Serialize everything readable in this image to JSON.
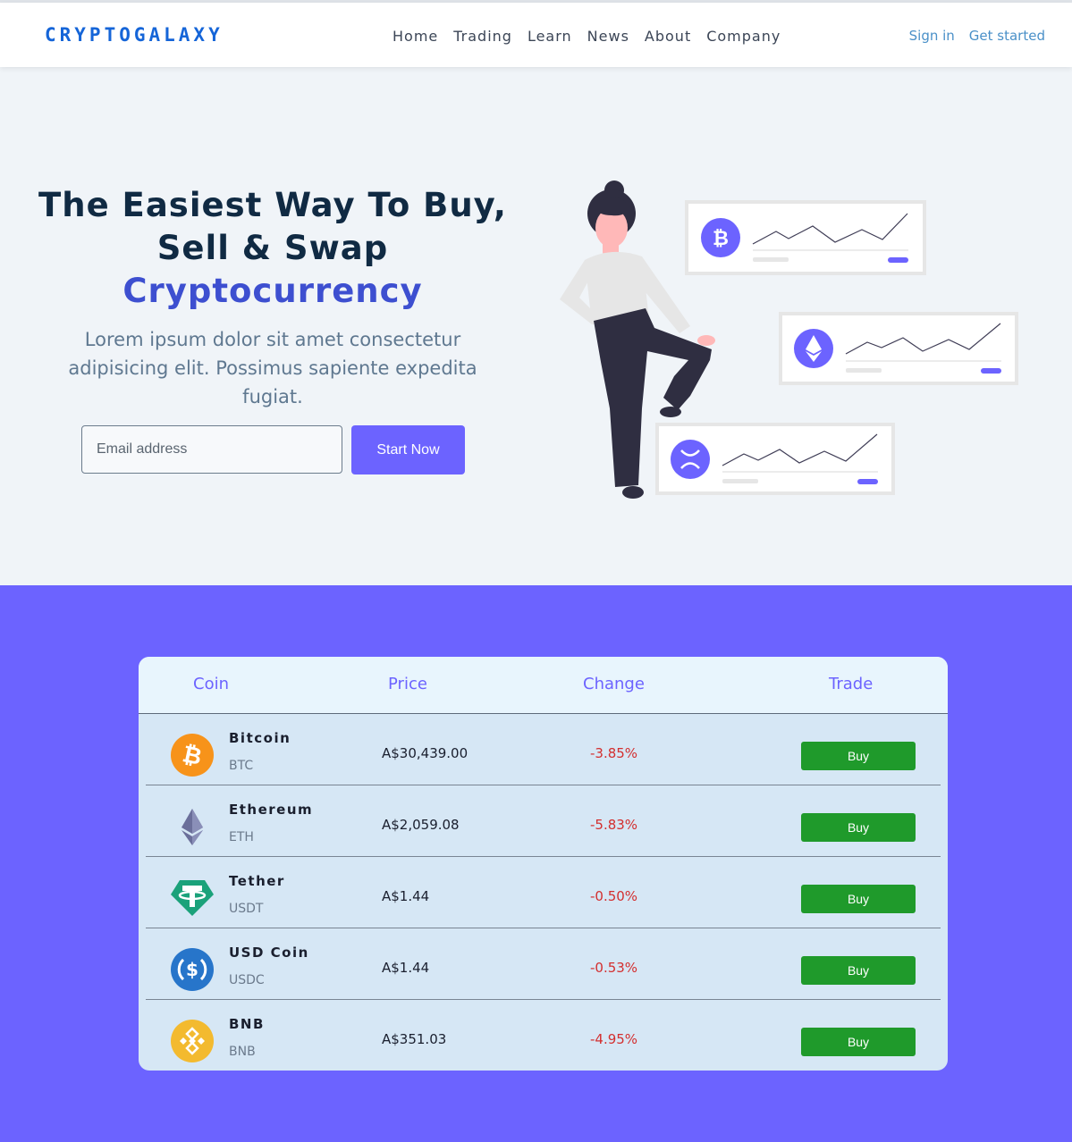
{
  "brand": "CRYPTOGALAXY",
  "nav": [
    "Home",
    "Trading",
    "Learn",
    "News",
    "About",
    "Company"
  ],
  "auth": {
    "sign_in": "Sign in",
    "get_started": "Get started"
  },
  "hero": {
    "title_line1": "The Easiest Way To Buy,",
    "title_line2": "Sell & Swap",
    "title_accent": "Cryptocurrency",
    "subtitle": "Lorem ipsum dolor sit amet consectetur adipisicing elit. Possimus sapiente expedita fugiat.",
    "email_placeholder": "Email address",
    "cta": "Start Now"
  },
  "colors": {
    "accent": "#6c63ff",
    "brand": "#1565d8",
    "buy": "#1f9a2b",
    "negative": "#d32f2f"
  },
  "table": {
    "headers": {
      "coin": "Coin",
      "price": "Price",
      "change": "Change",
      "trade": "Trade"
    },
    "rows": [
      {
        "name": "Bitcoin",
        "symbol": "BTC",
        "price": "A$30,439.00",
        "change": "-3.85%",
        "action": "Buy",
        "icon": "bitcoin-icon"
      },
      {
        "name": "Ethereum",
        "symbol": "ETH",
        "price": "A$2,059.08",
        "change": "-5.83%",
        "action": "Buy",
        "icon": "ethereum-icon"
      },
      {
        "name": "Tether",
        "symbol": "USDT",
        "price": "A$1.44",
        "change": "-0.50%",
        "action": "Buy",
        "icon": "tether-icon"
      },
      {
        "name": "USD Coin",
        "symbol": "USDC",
        "price": "A$1.44",
        "change": "-0.53%",
        "action": "Buy",
        "icon": "usd-coin-icon"
      },
      {
        "name": "BNB",
        "symbol": "BNB",
        "price": "A$351.03",
        "change": "-4.95%",
        "action": "Buy",
        "icon": "bnb-icon"
      }
    ]
  }
}
